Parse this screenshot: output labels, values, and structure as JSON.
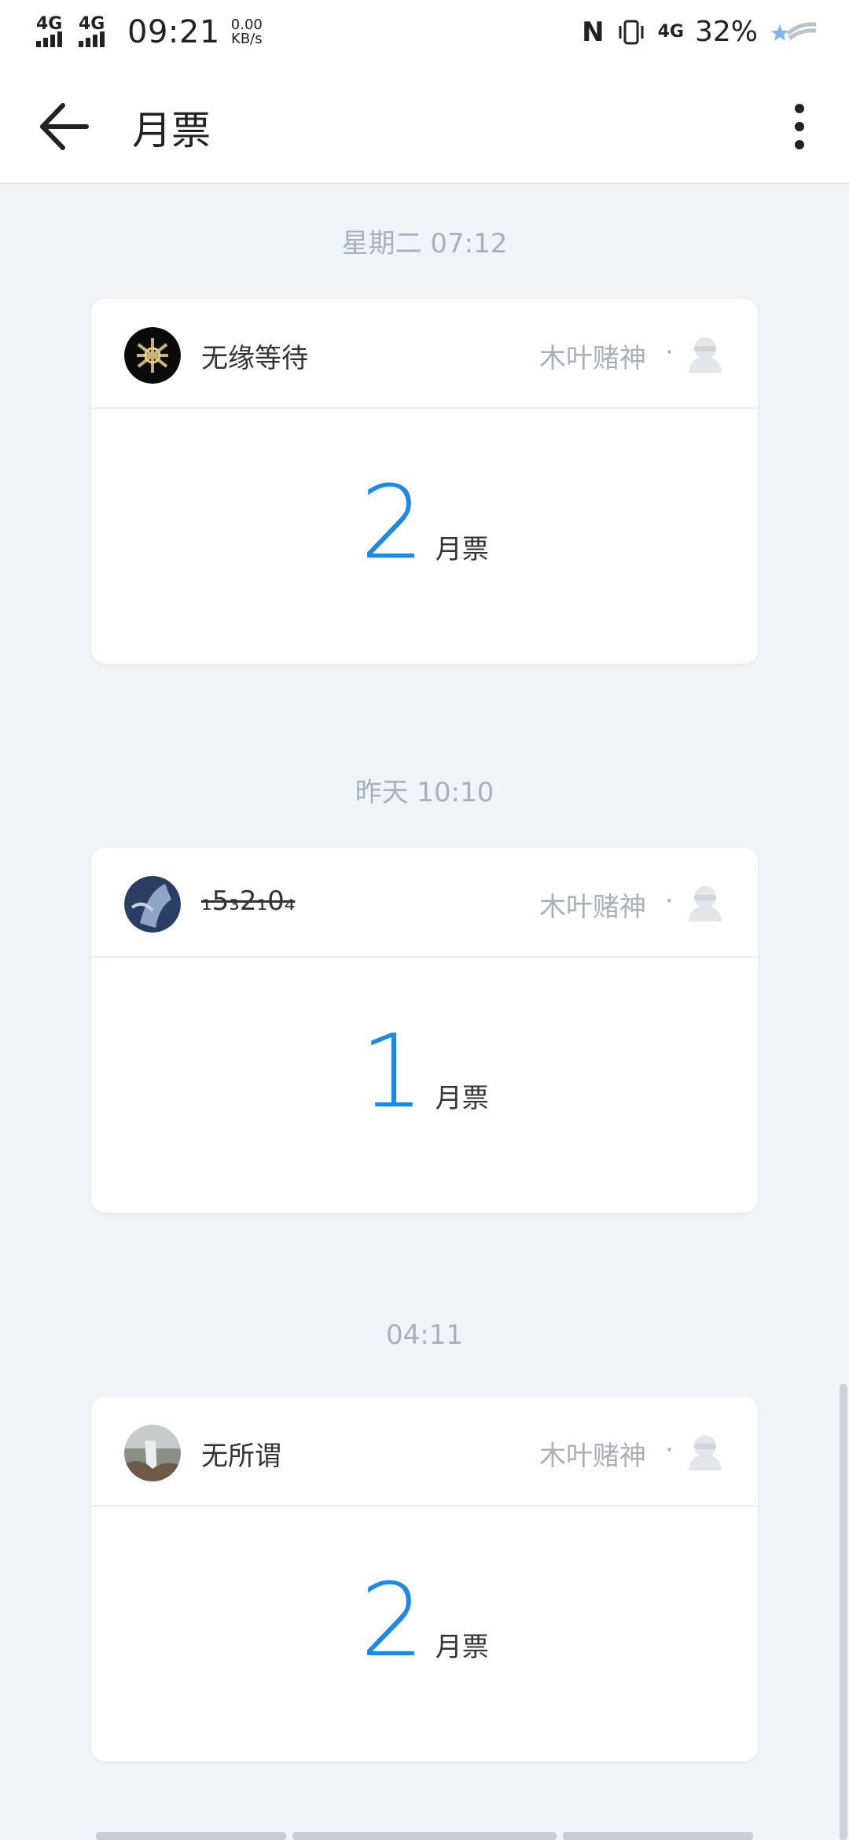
{
  "status_bar": {
    "sim1": "4G",
    "sim2": "4G",
    "time": "09:21",
    "speed_value": "0.00",
    "speed_unit": "KB/s",
    "network": "4G",
    "battery": "32%"
  },
  "app_bar": {
    "title": "月票"
  },
  "items": [
    {
      "time": "星期二 07:12",
      "sender": "无缘等待",
      "recipient": "木叶赌神",
      "separator": "·",
      "amount": "2",
      "unit": "月票"
    },
    {
      "time": "昨天 10:10",
      "sender": "₁5₃2₁0₄",
      "recipient": "木叶赌神",
      "separator": "·",
      "amount": "1",
      "unit": "月票"
    },
    {
      "time": "04:11",
      "sender": "无所谓",
      "recipient": "木叶赌神",
      "separator": "·",
      "amount": "2",
      "unit": "月票"
    }
  ],
  "colors": {
    "accent": "#1e88e5",
    "background": "#f0f4f8",
    "muted": "#a7b1bd"
  }
}
